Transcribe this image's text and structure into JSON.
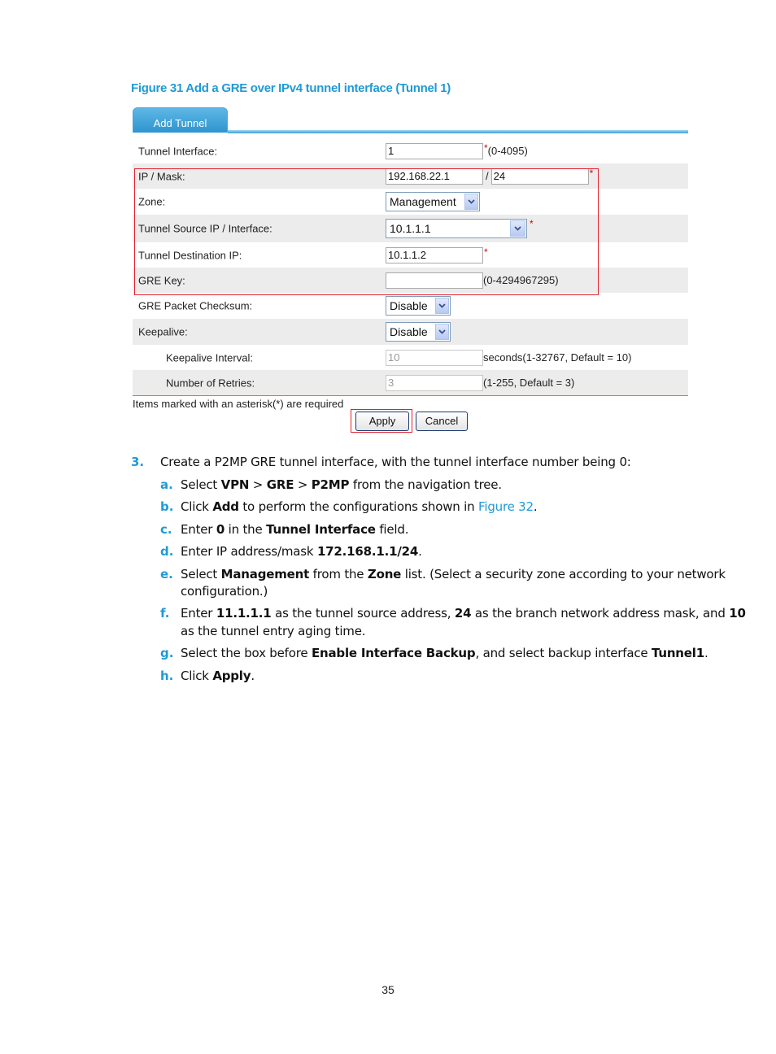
{
  "figure": {
    "caption": "Figure 31 Add a GRE over IPv4 tunnel interface (Tunnel 1)",
    "tab_label": "Add Tunnel",
    "rows": [
      {
        "label": "Tunnel Interface:",
        "value": "1",
        "hint": "(0-4095)",
        "required": true
      },
      {
        "label": "IP / Mask:",
        "ip": "192.168.22.1",
        "separator": "/",
        "mask": "24",
        "required": true
      },
      {
        "label": "Zone:",
        "selected": "Management"
      },
      {
        "label": "Tunnel Source IP / Interface:",
        "value": "10.1.1.1",
        "required": true
      },
      {
        "label": "Tunnel Destination IP:",
        "value": "10.1.1.2",
        "required": true
      },
      {
        "label": "GRE Key:",
        "value": "",
        "hint": "(0-4294967295)"
      },
      {
        "label": "GRE Packet Checksum:",
        "selected": "Disable"
      },
      {
        "label": "Keepalive:",
        "selected": "Disable"
      },
      {
        "label": "Keepalive Interval:",
        "value": "10",
        "hint": "seconds(1-32767, Default = 10)",
        "disabled": true
      },
      {
        "label": "Number of Retries:",
        "value": "3",
        "hint": "(1-255, Default = 3)",
        "disabled": true
      }
    ],
    "required_star": "*",
    "required_note": "Items marked with an asterisk(*) are required",
    "apply_label": "Apply",
    "cancel_label": "Cancel",
    "highlight_color": "#e5202e",
    "accent_color": "#3ea2d8"
  },
  "steps": {
    "step3": {
      "number": "3.",
      "text": "Create a P2MP GRE tunnel interface, with the tunnel interface number being 0:"
    },
    "a": {
      "letter": "a.",
      "t1": "Select ",
      "b1": "VPN",
      "t2": " > ",
      "b2": "GRE",
      "t3": " > ",
      "b3": "P2MP",
      "t4": " from the navigation tree."
    },
    "b": {
      "letter": "b.",
      "t1": "Click ",
      "b1": "Add",
      "t2": " to perform the configurations shown in ",
      "link": "Figure 32",
      "t3": "."
    },
    "c": {
      "letter": "c.",
      "t1": "Enter ",
      "b1": "0",
      "t2": " in the ",
      "b2": "Tunnel Interface",
      "t3": " field."
    },
    "d": {
      "letter": "d.",
      "t1": "Enter IP address/mask ",
      "b1": "172.168.1.1/24",
      "t2": "."
    },
    "e": {
      "letter": "e.",
      "t1": "Select ",
      "b1": "Management",
      "t2": " from the ",
      "b2": "Zone",
      "t3": " list. (Select a security zone according to your network",
      "line2": "configuration.)"
    },
    "f": {
      "letter": "f.",
      "t1": "Enter ",
      "b1": "11.1.1.1",
      "t2": " as the tunnel source address, ",
      "b2": "24",
      "t3": " as the branch network address mask, and ",
      "b3": "10",
      "line2": "as the tunnel entry aging time."
    },
    "g": {
      "letter": "g.",
      "t1": "Select the box before ",
      "b1": "Enable Interface Backup",
      "t2": ", and select backup interface ",
      "b2": "Tunnel1",
      "t3": "."
    },
    "h": {
      "letter": "h.",
      "t1": "Click ",
      "b1": "Apply",
      "t2": "."
    }
  },
  "page_number": "35",
  "colors": {
    "heading_blue": "#1f9ad6"
  }
}
